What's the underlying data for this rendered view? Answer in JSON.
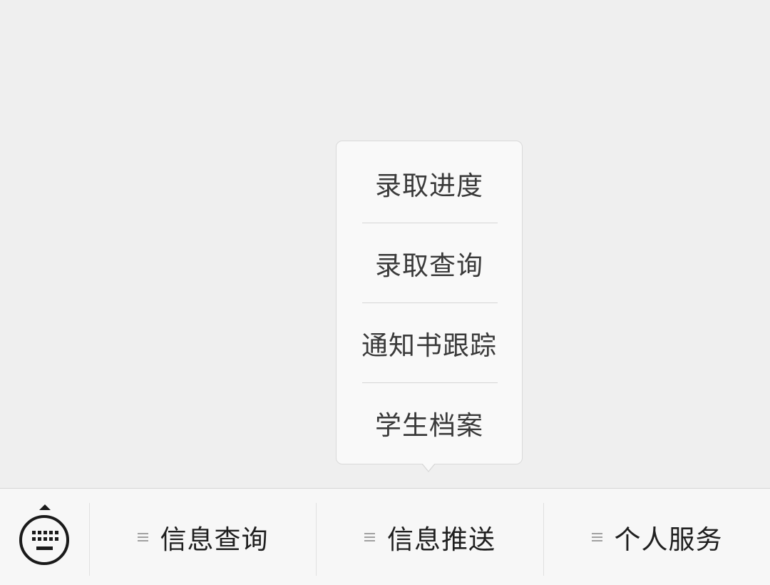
{
  "popup_menu": {
    "items": [
      {
        "label": "录取进度"
      },
      {
        "label": "录取查询"
      },
      {
        "label": "通知书跟踪"
      },
      {
        "label": "学生档案"
      }
    ]
  },
  "bottom_menu": {
    "keyboard_toggle_icon": "keyboard-icon",
    "tabs": [
      {
        "label": "信息查询",
        "icon": "menu-lines-icon"
      },
      {
        "label": "信息推送",
        "icon": "menu-lines-icon"
      },
      {
        "label": "个人服务",
        "icon": "menu-lines-icon"
      }
    ]
  }
}
